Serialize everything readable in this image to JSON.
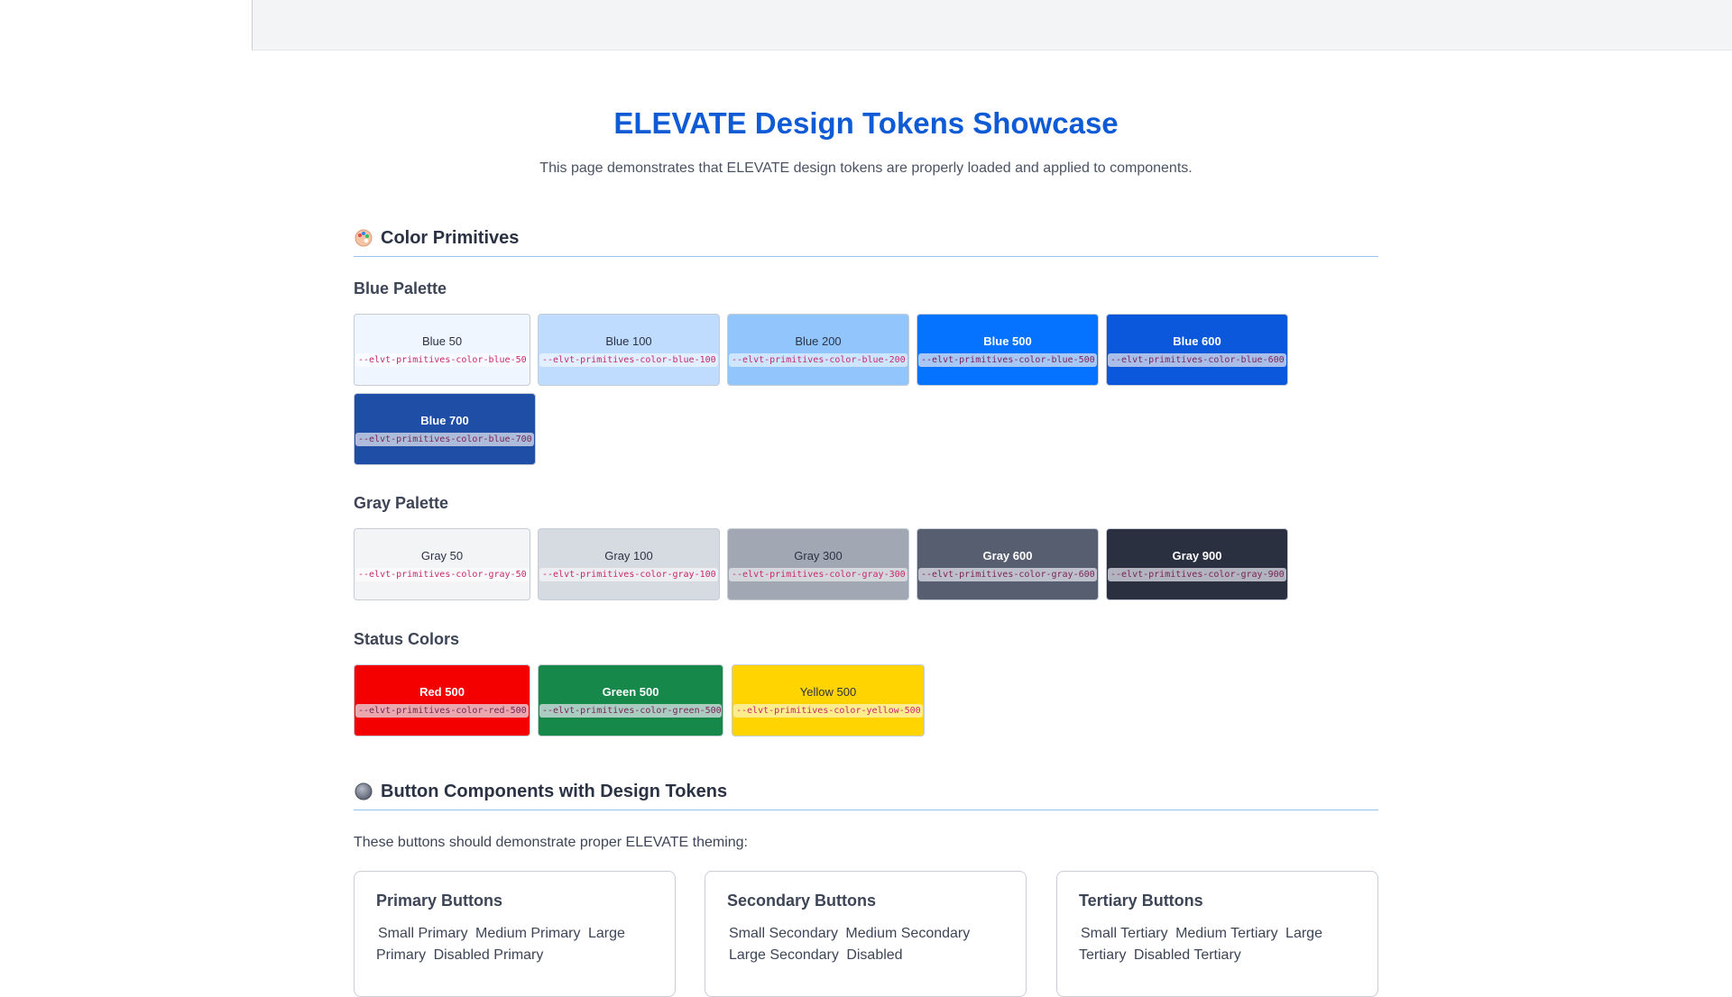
{
  "header": {
    "title": "ELEVATE Design Tokens Showcase",
    "subtitle": "This page demonstrates that ELEVATE design tokens are properly loaded and applied to components."
  },
  "sections": {
    "colors": {
      "title": "Color Primitives",
      "icon": "palette-icon"
    },
    "buttons": {
      "title": "Button Components with Design Tokens",
      "icon": "circle-icon"
    }
  },
  "palettes": {
    "blue": {
      "title": "Blue Palette",
      "swatches": [
        {
          "name": "Blue 50",
          "token": "--elvt-primitives-color-blue-50",
          "color": "#eff6ff"
        },
        {
          "name": "Blue 100",
          "token": "--elvt-primitives-color-blue-100",
          "color": "#bfdbfe"
        },
        {
          "name": "Blue 200",
          "token": "--elvt-primitives-color-blue-200",
          "color": "#93c5fd"
        },
        {
          "name": "Blue 500",
          "token": "--elvt-primitives-color-blue-500",
          "color": "#0573ff"
        },
        {
          "name": "Blue 600",
          "token": "--elvt-primitives-color-blue-600",
          "color": "#0b58dc"
        },
        {
          "name": "Blue 700",
          "token": "--elvt-primitives-color-blue-700",
          "color": "#1f4ea6"
        }
      ]
    },
    "gray": {
      "title": "Gray Palette",
      "swatches": [
        {
          "name": "Gray 50",
          "token": "--elvt-primitives-color-gray-50",
          "color": "#f3f4f6"
        },
        {
          "name": "Gray 100",
          "token": "--elvt-primitives-color-gray-100",
          "color": "#d6dae1"
        },
        {
          "name": "Gray 300",
          "token": "--elvt-primitives-color-gray-300",
          "color": "#a1a8b3"
        },
        {
          "name": "Gray 600",
          "token": "--elvt-primitives-color-gray-600",
          "color": "#565e70"
        },
        {
          "name": "Gray 900",
          "token": "--elvt-primitives-color-gray-900",
          "color": "#2b3040"
        }
      ]
    },
    "status": {
      "title": "Status Colors",
      "swatches": [
        {
          "name": "Red 500",
          "token": "--elvt-primitives-color-red-500",
          "color": "#f40000"
        },
        {
          "name": "Green 500",
          "token": "--elvt-primitives-color-green-500",
          "color": "#15884a"
        },
        {
          "name": "Yellow 500",
          "token": "--elvt-primitives-color-yellow-500",
          "color": "#ffd400"
        }
      ]
    }
  },
  "buttons": {
    "intro": "These buttons should demonstrate proper ELEVATE theming:",
    "cards": [
      {
        "title": "Primary Buttons",
        "buttons": [
          "Small Primary",
          "Medium Primary",
          "Large Primary",
          "Disabled Primary"
        ]
      },
      {
        "title": "Secondary Buttons",
        "buttons": [
          "Small Secondary",
          "Medium Secondary",
          "Large Secondary",
          "Disabled"
        ]
      },
      {
        "title": "Tertiary Buttons",
        "buttons": [
          "Small Tertiary",
          "Medium Tertiary",
          "Large Tertiary",
          "Disabled Tertiary"
        ]
      }
    ]
  }
}
